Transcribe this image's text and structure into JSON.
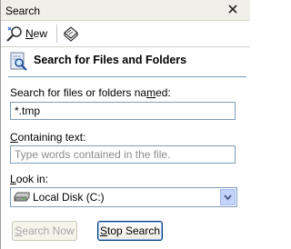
{
  "panel": {
    "title": "Search"
  },
  "toolbar": {
    "new_label": "New",
    "new_accel": "N",
    "new_rest": "ew"
  },
  "header": {
    "title": "Search for Files and Folders"
  },
  "fields": {
    "name_label_pre": "Search for files or folders na",
    "name_label_accel": "m",
    "name_label_post": "ed:",
    "name_value": "*.tmp",
    "content_label_accel": "C",
    "content_label_rest": "ontaining text:",
    "content_placeholder": "Type words contained in the file.",
    "lookin_label_accel": "L",
    "lookin_label_rest": "ook in:",
    "lookin_value": "Local Disk (C:)"
  },
  "buttons": {
    "search_now_accel": "S",
    "search_now_rest": "earch Now",
    "stop_accel": "S",
    "stop_rest": "top Search"
  },
  "icons": {
    "close": "close-icon",
    "new": "new-search-icon",
    "help": "help-book-icon",
    "header": "search-magnifier-icon",
    "drive": "hard-drive-icon",
    "dropdown": "chevron-down-icon"
  }
}
